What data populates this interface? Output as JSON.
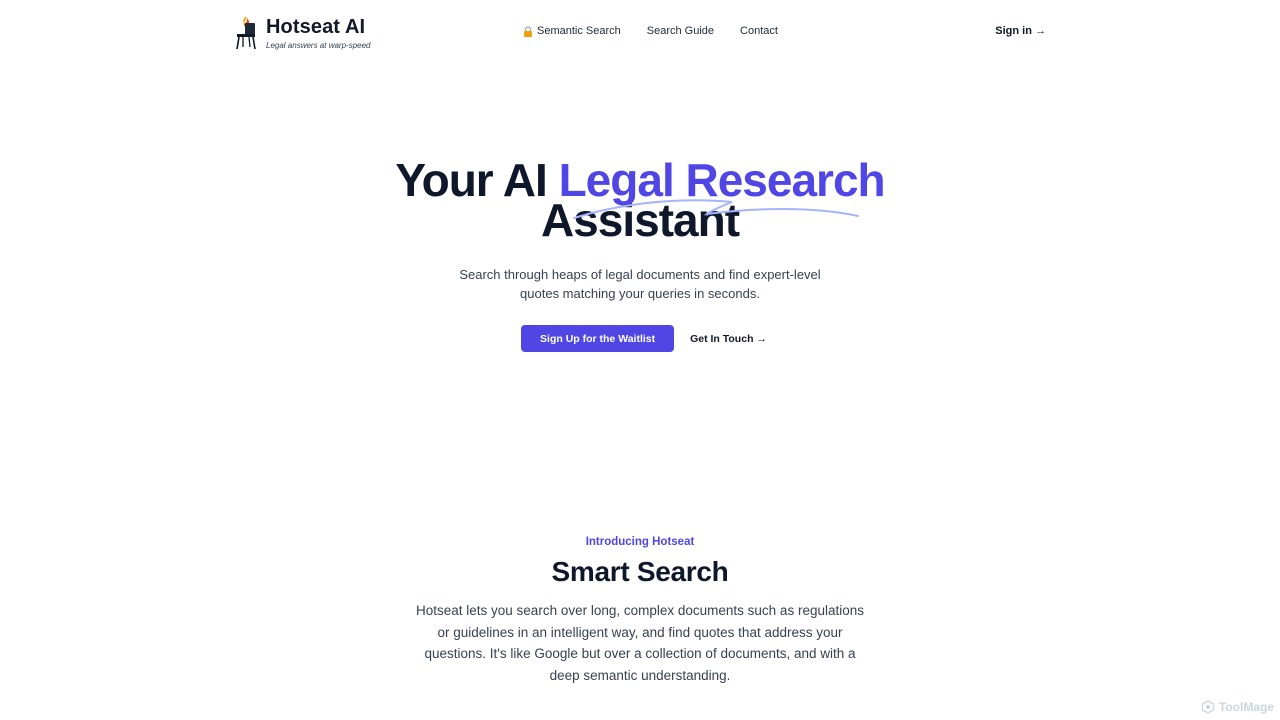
{
  "header": {
    "brand_name": "Hotseat AI",
    "brand_tagline": "Legal answers at warp-speed",
    "nav": [
      {
        "label": "Semantic Search",
        "icon": "lock-icon"
      },
      {
        "label": "Search Guide"
      },
      {
        "label": "Contact"
      }
    ],
    "signin_label": "Sign in →"
  },
  "hero": {
    "title_prefix": "Your AI",
    "title_accent": "Legal Research",
    "title_line2": "Assistant",
    "subtitle": "Search through heaps of legal documents and find expert-level quotes matching your queries in seconds.",
    "primary_cta": "Sign Up for the Waitlist",
    "secondary_cta": "Get In Touch →"
  },
  "intro": {
    "eyebrow": "Introducing Hotseat",
    "title": "Smart Search",
    "body": "Hotseat lets you search over long, complex documents such as regulations or guidelines in an intelligent way, and find quotes that address your questions. It's like Google but over a collection of documents, and with a deep semantic understanding."
  },
  "watermark": {
    "label": "ToolMage"
  },
  "colors": {
    "accent": "#4f46e5",
    "text": "#0f172a",
    "muted": "#374151"
  }
}
